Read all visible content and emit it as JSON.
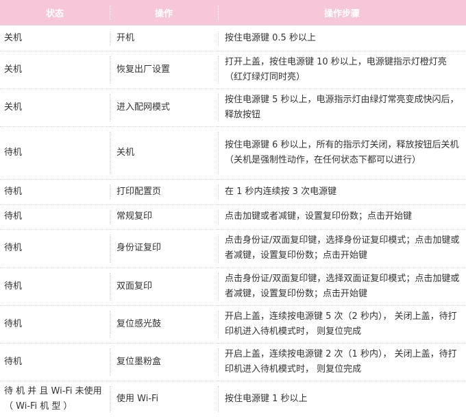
{
  "table": {
    "headers": [
      "状态",
      "操作",
      "操作步骤"
    ],
    "rows": [
      [
        "关机",
        "开机",
        "按住电源键 0.5 秒以上"
      ],
      [
        "关机",
        "恢复出厂设置",
        "打开上盖，按住电源键 10 秒以上，电源键指示灯橙灯亮（红灯绿灯同时亮）"
      ],
      [
        "关机",
        "进入配网模式",
        "按住电源键 5 秒以上，电源指示灯由绿灯常亮变成快闪后，释放按钮"
      ],
      [
        "待机",
        "关机",
        "按住电源键 6 秒以上，所有的指示灯关闭，释放按钮后关机（关机是强制性动作，在任何状态下都可以进行）"
      ],
      [
        "待机",
        "打印配置页",
        "在 1 秒内连续按 3 次电源键"
      ],
      [
        "待机",
        "常规复印",
        "点击加键或者减键，设置复印份数；点击开始键"
      ],
      [
        "待机",
        "身份证复印",
        "点击身份证/双面复印键，选择身份证复印模式；点击加键或者减键，设置复印份数；点击开始键"
      ],
      [
        "待机",
        "双面复印",
        "点击身份证/双面复印键，选择双面证复印模式；点击加键或者减键，设置复印份数；点击开始键"
      ],
      [
        "待机",
        "复位感光鼓",
        "开启上盖，连续按电源键 5 次（2 秒内）， 关闭上盖，待打印机进入待机模式时， 则复位完成"
      ],
      [
        "待机",
        "复位墨粉盒",
        "开启上盖，连续按电源键 2 次（1 秒内）， 关闭上盖，待打印机进入待机模式时， 则复位完成"
      ],
      [
        "待 机 并 且 Wi-Fi 未使用（ Wi-Fi 机 型 ）",
        "使用 Wi-Fi",
        "按住电源键 1 秒以上"
      ]
    ]
  }
}
